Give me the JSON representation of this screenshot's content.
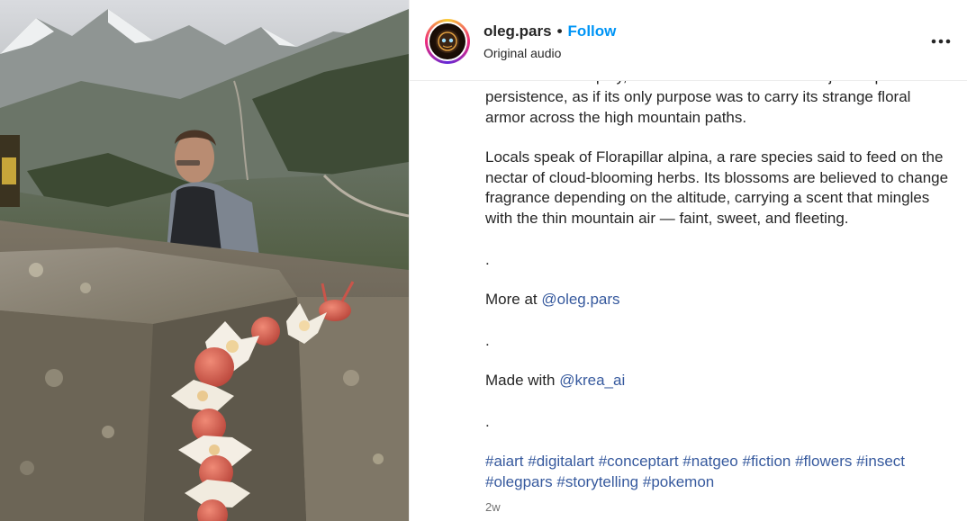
{
  "post": {
    "username": "oleg.pars",
    "separator": "•",
    "follow_label": "Follow",
    "audio_label": "Original audio",
    "more_icon": "more-horizontal-icon",
    "timestamp": "2w"
  },
  "caption": {
    "cut_line": "no defensive display, no sudden transformation — just a quiet",
    "para1_rest": "persistence, as if its only purpose was to carry its strange floral armor across the high mountain paths.",
    "para2": "Locals speak of Florapillar alpina, a rare species said to feed on the nectar of cloud-blooming herbs. Its blossoms are believed to change fragrance depending on the altitude, carrying a scent that mingles with the thin mountain air — faint, sweet, and fleeting.",
    "dot1": ".",
    "more_prefix": "More at ",
    "more_mention": "@oleg.pars",
    "dot2": ".",
    "made_prefix": "Made with ",
    "made_mention": "@krea_ai",
    "dot3": ".",
    "hashtags": [
      "#aiart",
      "#digitalart",
      "#conceptart",
      "#natgeo",
      "#fiction",
      "#flowers",
      "#insect",
      "#olegpars",
      "#storytelling",
      "#pokemon"
    ]
  },
  "media": {
    "description_icon": "photo",
    "colors": {
      "sky": "#c9ccd0",
      "mountain": "#6e7670",
      "grass": "#5f7247",
      "stone": "#8b8578",
      "flower_white": "#f4efe6",
      "flower_red": "#d5604f"
    }
  },
  "colors": {
    "follow": "#0095f6",
    "link": "#375a9e",
    "muted": "#737373"
  }
}
